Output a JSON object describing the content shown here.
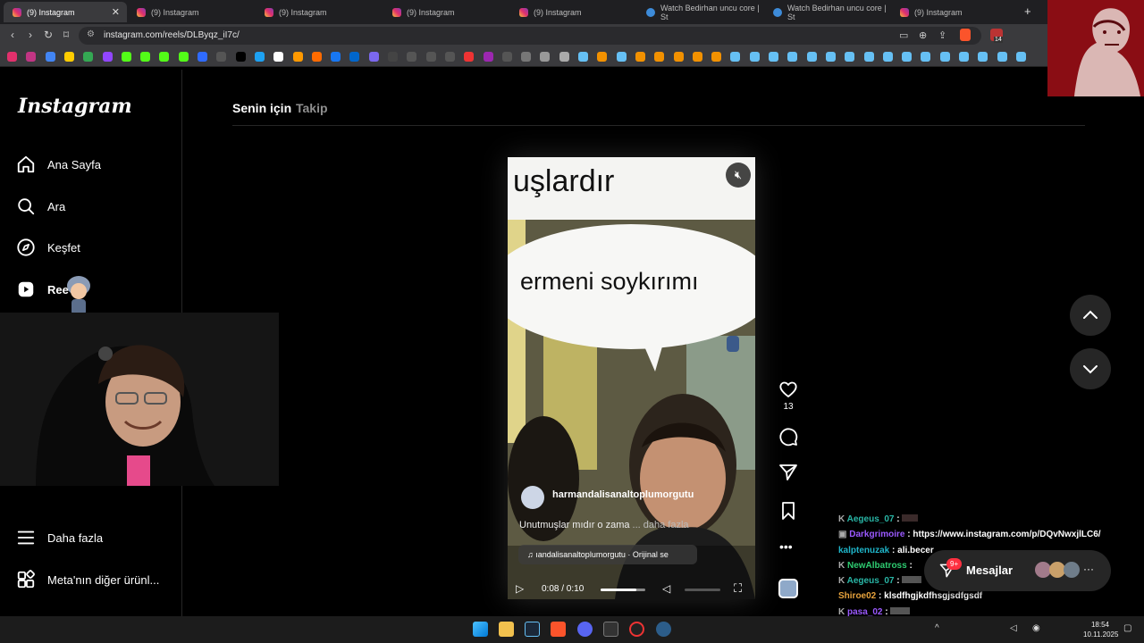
{
  "browser": {
    "tabs": [
      {
        "title": "(9) Instagram",
        "active": true,
        "favicon": "instagram-icon"
      },
      {
        "title": "(9) Instagram",
        "favicon": "instagram-icon"
      },
      {
        "title": "(9) Instagram",
        "favicon": "instagram-icon"
      },
      {
        "title": "(9) Instagram",
        "favicon": "instagram-icon"
      },
      {
        "title": "(9) Instagram",
        "favicon": "instagram-icon"
      },
      {
        "title": "Watch Bedirhan uncu core | St",
        "favicon": "twitch-icon"
      },
      {
        "title": "Watch Bedirhan uncu core | St",
        "favicon": "twitch-icon"
      },
      {
        "title": "(9) Instagram",
        "favicon": "instagram-icon"
      }
    ],
    "new_tab": "+",
    "url": "instagram.com/reels/DLByqz_iI7c/",
    "extension_badge": "14"
  },
  "instagram": {
    "logo": "Instagram",
    "nav": [
      {
        "label": "Ana Sayfa",
        "icon": "home-icon"
      },
      {
        "label": "Ara",
        "icon": "search-icon"
      },
      {
        "label": "Keşfet",
        "icon": "compass-icon"
      },
      {
        "label": "Ree",
        "icon": "reels-icon"
      }
    ],
    "more": {
      "label": "Daha fazla",
      "icon": "menu-icon"
    },
    "meta": {
      "label": "Meta'nın diğer ürünl...",
      "icon": "apps-icon"
    },
    "feed_tabs": [
      "Senin için",
      "Takip"
    ],
    "reel": {
      "text_top": "uşlardır",
      "bubble_text": "ermeni soykırımı",
      "username": "harmandalisanaltoplumorgutu",
      "caption": "Unutmuşlar mıdır o zama",
      "caption_more": "... daha fazla",
      "audio": "ıandalisanaltoplumorgutu · Orijinal se",
      "time": "0:08 / 0:10",
      "progress": 0.8,
      "likes": "13"
    },
    "messages_label": "Mesajlar",
    "messages_badge": "9+"
  },
  "chat": [
    {
      "user": "Aegeus_07",
      "message": "",
      "color": "#29b6a6"
    },
    {
      "user": "Darkgrimoire",
      "message": "https://www.instagram.com/p/DQvNwxjlLC6/",
      "color": "#9b59ff"
    },
    {
      "user": "kalptenuzak",
      "message": "ali.becer",
      "color": "#1fb5c9"
    },
    {
      "user": "NewAlbatross",
      "message": "",
      "color": "#2ecc71"
    },
    {
      "user": "Aegeus_07",
      "message": "",
      "color": "#29b6a6"
    },
    {
      "user": "Shiroe02",
      "message": "klsdfhgjkdfhsgjsdfgsdf",
      "color": "#e6a23c"
    },
    {
      "user": "pasa_02",
      "message": "",
      "color": "#9b59ff"
    }
  ],
  "system": {
    "time": "18:54",
    "date": "10.11.2025"
  }
}
